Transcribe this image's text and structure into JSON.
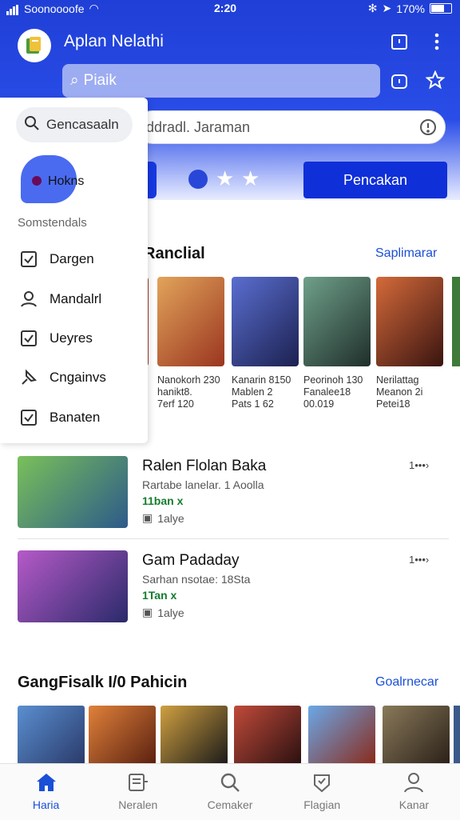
{
  "status_bar": {
    "carrier": "Soonoooofe",
    "time": "2:20",
    "battery_text": "170%"
  },
  "app": {
    "title": "Aplan Nelathi"
  },
  "header": {
    "search_placeholder": "Piaik",
    "secondary_search_text": "ddradl. Jaraman",
    "primary_button": "Pencakan"
  },
  "drawer": {
    "search_text": "Gencasaaln",
    "active_item": "Hokns",
    "section_label": "Somstendals",
    "items": [
      {
        "label": "Dargen",
        "icon": "checkbox-icon"
      },
      {
        "label": "Mandalrl",
        "icon": "person-icon"
      },
      {
        "label": "Ueyres",
        "icon": "checkbox-icon"
      },
      {
        "label": "Cngainvs",
        "icon": "pin-icon"
      },
      {
        "label": "Banaten",
        "icon": "checkbox-icon"
      }
    ]
  },
  "section1": {
    "title": "Ranclial",
    "link": "Saplimarar",
    "cards": [
      {
        "line1": "Nanokorh 230",
        "line2": "hanikt8.",
        "line3": "7erf 120",
        "color": "#c8693a"
      },
      {
        "line1": "Kanarin 8150",
        "line2": "Mablen 2",
        "line3": "Pats 1 62",
        "color": "#3a3f7a"
      },
      {
        "line1": "Peorinoh 130",
        "line2": "Fanalee18",
        "line3": "00.019",
        "color": "#2f4d44"
      },
      {
        "line1": "Nerilattag",
        "line2": "Meanon 2i",
        "line3": "Petei18",
        "color": "#8a2a1f"
      }
    ]
  },
  "list": [
    {
      "title": "Ralen Flolan Baka",
      "sub": "Rartabe lanelar. 1 Aoolla",
      "price": "11ban x",
      "badge": "1alye",
      "more": "1•••›",
      "color": "#4f8a3a"
    },
    {
      "title": "Gam Padaday",
      "sub": "Sarhan nsotae: 18Sta",
      "price": "1Tan x",
      "badge": "1alye",
      "more": "1•••›",
      "color": "#6b2f7a"
    }
  ],
  "section2": {
    "title": "GangFisalk I/0 Pahicin",
    "link": "Goalrnecar",
    "thumbs": [
      "#3b6fb0",
      "#a8461e",
      "#2a2a2a",
      "#7a2b2b",
      "#2a56a8",
      "#4a3a28"
    ]
  },
  "nav": [
    {
      "label": "Haria",
      "icon": "home-icon",
      "active": true
    },
    {
      "label": "Neralen",
      "icon": "list-icon",
      "active": false
    },
    {
      "label": "Cemaker",
      "icon": "search-icon",
      "active": false
    },
    {
      "label": "Flagian",
      "icon": "badge-icon",
      "active": false
    },
    {
      "label": "Kanar",
      "icon": "profile-icon",
      "active": false
    }
  ],
  "colors": {
    "primary": "#1f3fd6",
    "link": "#1a4fd6",
    "price": "#157d2e"
  }
}
